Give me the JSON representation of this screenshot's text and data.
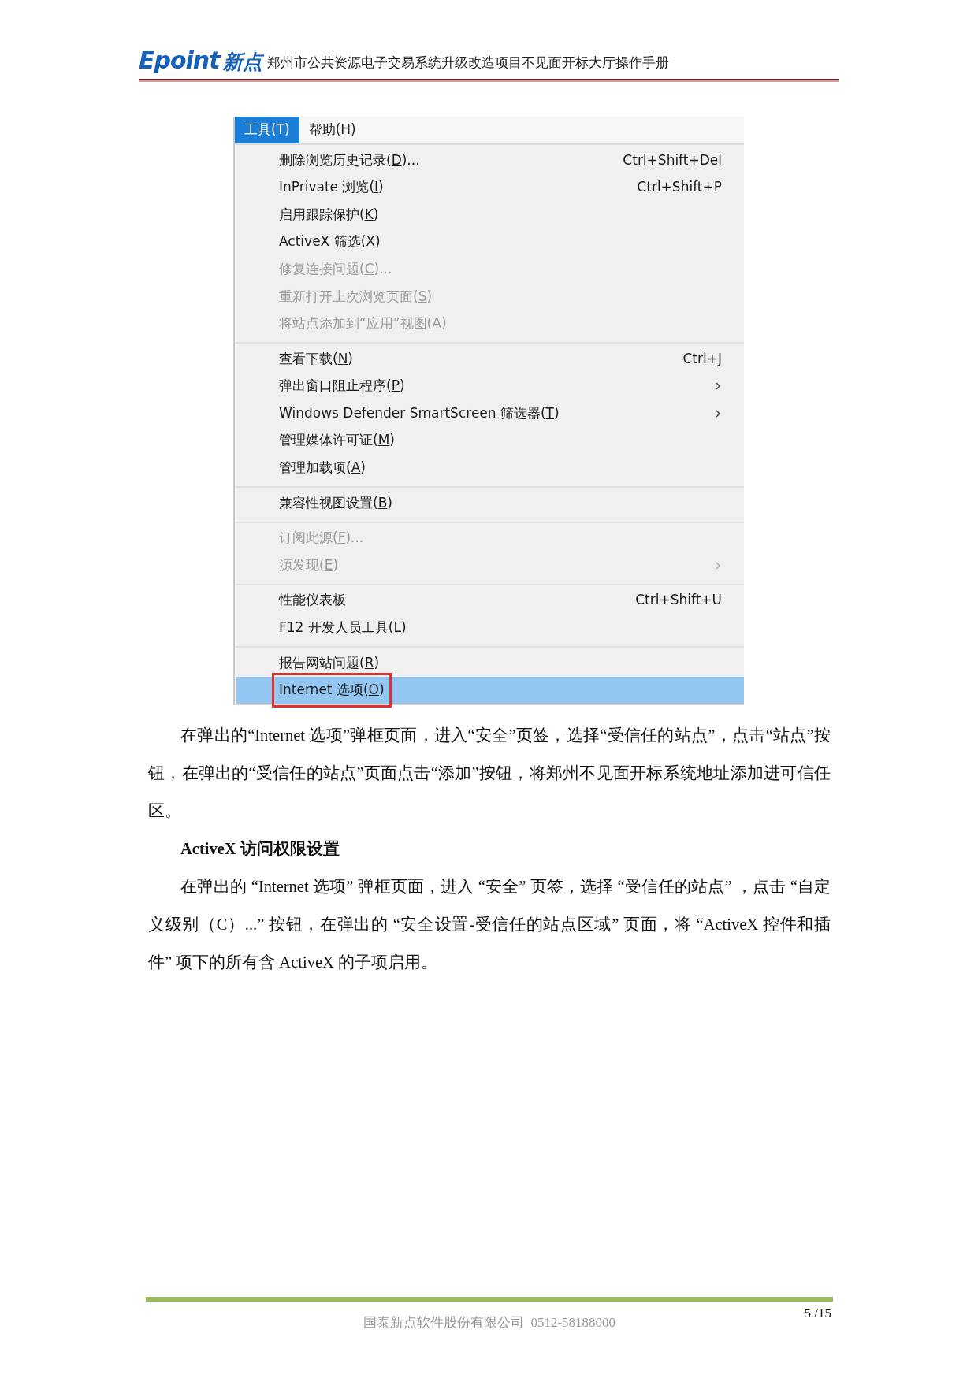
{
  "header": {
    "logo_latin": "Epoint",
    "logo_cjk": "新点",
    "title": "郑州市公共资源电子交易系统升级改造项目不见面开标大厅操作手册"
  },
  "menu": {
    "menubar": [
      {
        "label": "工具(T)",
        "selected": true
      },
      {
        "label": "帮助(H)",
        "selected": false
      }
    ],
    "groups": [
      [
        {
          "before": "删除浏览历史记录(",
          "key": "D",
          "after": ")...",
          "shortcut": "Ctrl+Shift+Del",
          "disabled": false,
          "submenu": false,
          "selected": false
        },
        {
          "before": "InPrivate 浏览(",
          "key": "I",
          "after": ")",
          "shortcut": "Ctrl+Shift+P",
          "disabled": false,
          "submenu": false,
          "selected": false
        },
        {
          "before": "启用跟踪保护(",
          "key": "K",
          "after": ")",
          "disabled": false,
          "submenu": false,
          "selected": false
        },
        {
          "before": "ActiveX 筛选(",
          "key": "X",
          "after": ")",
          "disabled": false,
          "submenu": false,
          "selected": false
        },
        {
          "before": "修复连接问题(",
          "key": "C",
          "after": ")...",
          "disabled": true,
          "submenu": false,
          "selected": false
        },
        {
          "before": "重新打开上次浏览页面(",
          "key": "S",
          "after": ")",
          "disabled": true,
          "submenu": false,
          "selected": false
        },
        {
          "before": "将站点添加到“应用”视图(",
          "key": "A",
          "after": ")",
          "disabled": true,
          "submenu": false,
          "selected": false
        }
      ],
      [
        {
          "before": "查看下载(",
          "key": "N",
          "after": ")",
          "shortcut": "Ctrl+J",
          "disabled": false,
          "submenu": false,
          "selected": false
        },
        {
          "before": "弹出窗口阻止程序(",
          "key": "P",
          "after": ")",
          "disabled": false,
          "submenu": true,
          "selected": false
        },
        {
          "before": "Windows Defender SmartScreen 筛选器(",
          "key": "T",
          "after": ")",
          "disabled": false,
          "submenu": true,
          "selected": false
        },
        {
          "before": "管理媒体许可证(",
          "key": "M",
          "after": ")",
          "disabled": false,
          "submenu": false,
          "selected": false
        },
        {
          "before": "管理加载项(",
          "key": "A",
          "after": ")",
          "disabled": false,
          "submenu": false,
          "selected": false
        }
      ],
      [
        {
          "before": "兼容性视图设置(",
          "key": "B",
          "after": ")",
          "disabled": false,
          "submenu": false,
          "selected": false
        }
      ],
      [
        {
          "before": "订阅此源(",
          "key": "F",
          "after": ")...",
          "disabled": true,
          "submenu": false,
          "selected": false
        },
        {
          "before": "源发现(",
          "key": "E",
          "after": ")",
          "disabled": true,
          "submenu": true,
          "selected": false
        }
      ],
      [
        {
          "before": "性能仪表板",
          "shortcut": "Ctrl+Shift+U",
          "disabled": false,
          "submenu": false,
          "selected": false
        },
        {
          "before": "F12 开发人员工具(",
          "key": "L",
          "after": ")",
          "disabled": false,
          "submenu": false,
          "selected": false
        }
      ],
      [
        {
          "before": "报告网站问题(",
          "key": "R",
          "after": ")",
          "disabled": false,
          "submenu": false,
          "selected": false
        },
        {
          "before": "Internet 选项(",
          "key": "O",
          "after": ")",
          "disabled": false,
          "submenu": false,
          "selected": true,
          "marked": true
        }
      ]
    ]
  },
  "body": [
    {
      "kind": "paragraph",
      "text": "在弹出的“Internet 选项”弹框页面，进入“安全”页签，选择“受信任的站点”，点击“站点”按钮，在弹出的“受信任的站点”页面点击“添加”按钮，将郑州不见面开标系统地址添加进可信任区。"
    },
    {
      "kind": "heading",
      "text": "ActiveX 访问权限设置"
    },
    {
      "kind": "paragraph",
      "text": "在弹出的 “Internet 选项” 弹框页面，进入 “安全” 页签，选择 “受信任的站点” ，点击 “自定义级别（C）...” 按钮，在弹出的 “安全设置-受信任的站点区域” 页面，将 “ActiveX 控件和插件” 项下的所有含 ActiveX 的子项启用。"
    }
  ],
  "footer": {
    "company": "国泰新点软件股份有限公司  0512-58188000",
    "page": "5 /15"
  }
}
